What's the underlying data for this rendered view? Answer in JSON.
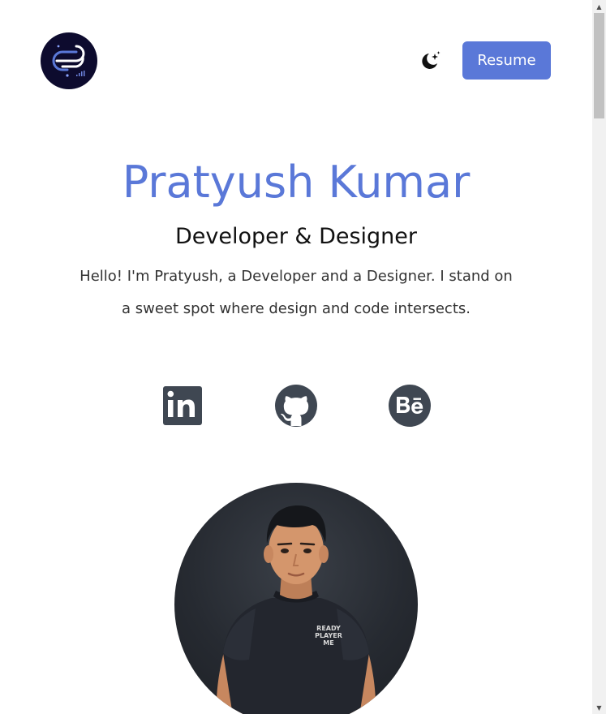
{
  "header": {
    "logo_icon": "brand-logo-icon",
    "theme_toggle_icon": "moon-stars-icon",
    "resume_label": "Resume"
  },
  "hero": {
    "name": "Pratyush Kumar",
    "role": "Developer & Designer",
    "bio": "Hello! I'm Pratyush, a Developer and a Designer. I stand on a sweet spot where design and code intersects."
  },
  "socials": [
    {
      "name": "linkedin",
      "icon": "linkedin-icon"
    },
    {
      "name": "github",
      "icon": "github-icon"
    },
    {
      "name": "behance",
      "icon": "behance-icon"
    }
  ],
  "avatar": {
    "shirt_text_lines": [
      "READY",
      "PLAYER",
      "ME"
    ]
  },
  "colors": {
    "accent": "#5a78d8",
    "logo_bg": "#0d0b2e",
    "icon_gray": "#3f4752"
  }
}
